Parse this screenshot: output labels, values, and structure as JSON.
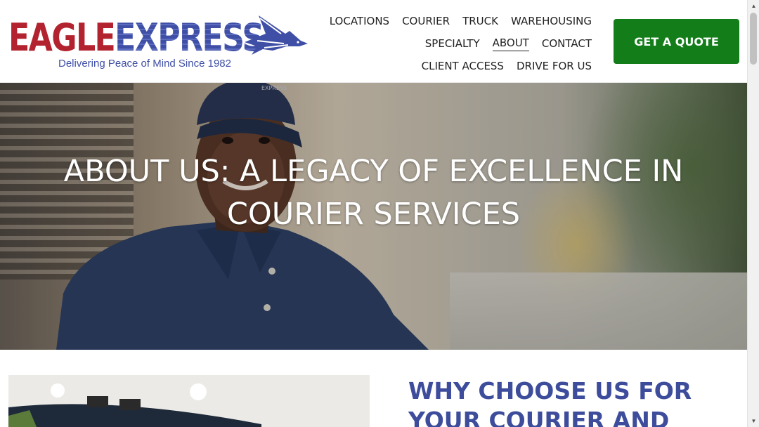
{
  "brand": {
    "name_part1": "EAGLE",
    "name_part2": "EXPRESS",
    "tagline": "Delivering Peace of Mind Since 1982",
    "colors": {
      "red": "#b3232f",
      "blue": "#3f4fa6",
      "green": "#137d1a"
    }
  },
  "nav": {
    "row1": [
      {
        "label": "LOCATIONS"
      },
      {
        "label": "COURIER"
      },
      {
        "label": "TRUCK"
      },
      {
        "label": "WAREHOUSING"
      }
    ],
    "row2": [
      {
        "label": "SPECIALTY"
      },
      {
        "label": "ABOUT",
        "active": true
      },
      {
        "label": "CONTACT"
      }
    ],
    "row3": [
      {
        "label": "CLIENT ACCESS"
      },
      {
        "label": "DRIVE FOR US"
      }
    ]
  },
  "cta": {
    "label": "GET A QUOTE"
  },
  "hero": {
    "title_line1": "ABOUT US: A LEGACY OF EXCELLENCE IN",
    "title_line2": "COURIER SERVICES",
    "cap_text": "EXPRESS"
  },
  "section2": {
    "title_line1": "WHY CHOOSE US FOR",
    "title_line2": "YOUR COURIER AND"
  },
  "icons": {
    "logo": "eagle-bird-icon",
    "scroll_up": "chevron-up-icon",
    "scroll_down": "chevron-down-icon"
  }
}
